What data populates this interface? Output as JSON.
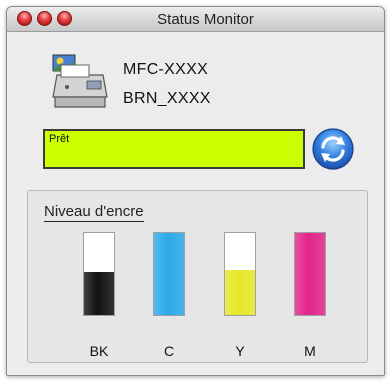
{
  "window": {
    "title": "Status Monitor"
  },
  "device": {
    "model": "MFC-XXXX",
    "node": "BRN_XXXX",
    "icon": "printer-icon"
  },
  "status": {
    "text": "Prêt",
    "color": "#ccff00"
  },
  "refresh": {
    "icon": "refresh-icon"
  },
  "ink": {
    "heading": "Niveau d'encre",
    "cartridges": [
      {
        "label": "BK",
        "level": 0.53,
        "color": "#111111"
      },
      {
        "label": "C",
        "level": 1.0,
        "color": "#2aa9e8"
      },
      {
        "label": "Y",
        "level": 0.55,
        "color": "#e6e628"
      },
      {
        "label": "M",
        "level": 1.0,
        "color": "#e0258a"
      }
    ]
  }
}
